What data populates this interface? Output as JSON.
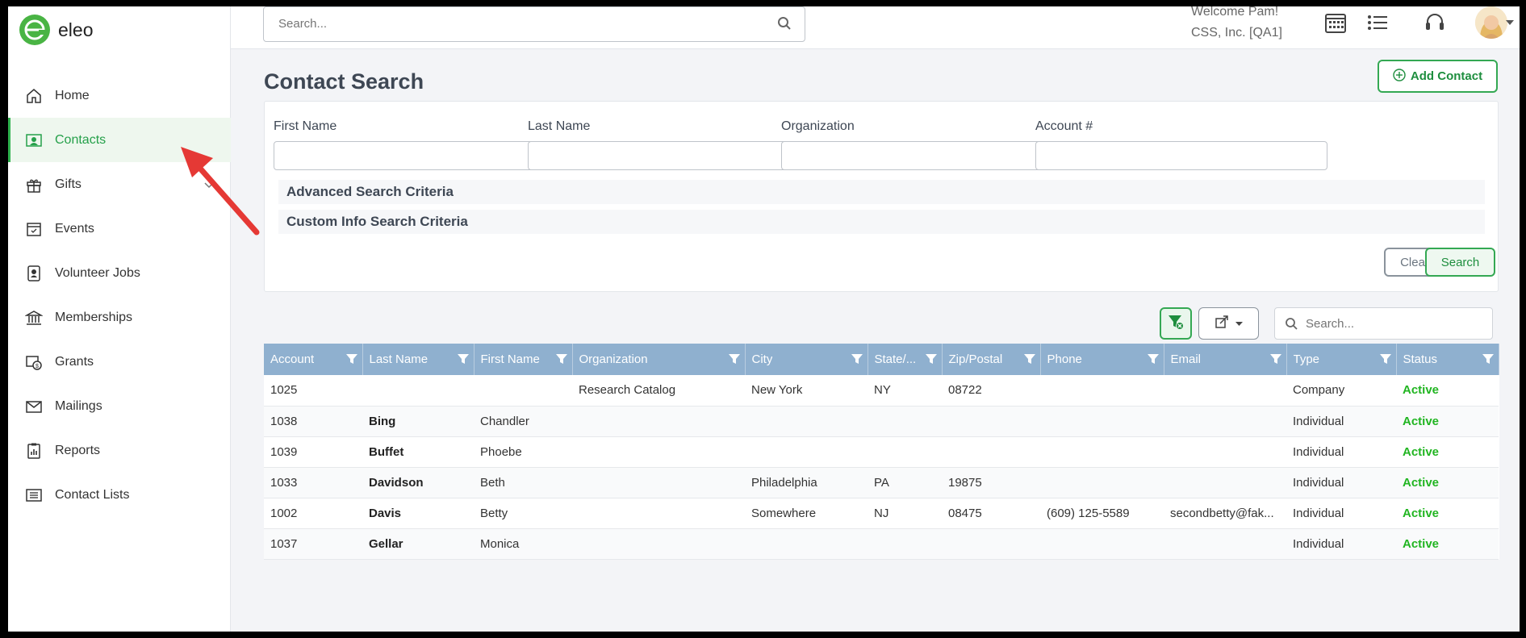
{
  "app": {
    "brand": "eleo"
  },
  "sidebar": {
    "items": [
      {
        "label": "Home",
        "icon": "home-icon"
      },
      {
        "label": "Contacts",
        "icon": "contact-card-icon",
        "active": true
      },
      {
        "label": "Gifts",
        "icon": "gift-icon",
        "expandable": true
      },
      {
        "label": "Events",
        "icon": "calendar-check-icon"
      },
      {
        "label": "Volunteer Jobs",
        "icon": "badge-icon"
      },
      {
        "label": "Memberships",
        "icon": "bank-icon"
      },
      {
        "label": "Grants",
        "icon": "grant-icon"
      },
      {
        "label": "Mailings",
        "icon": "envelope-icon"
      },
      {
        "label": "Reports",
        "icon": "clipboard-chart-icon"
      },
      {
        "label": "Contact Lists",
        "icon": "list-icon"
      }
    ]
  },
  "header": {
    "search_placeholder": "Search...",
    "welcome": "Welcome Pam!",
    "org": "CSS, Inc. [QA1]"
  },
  "page": {
    "title": "Contact Search",
    "add_contact_label": "Add Contact"
  },
  "search_form": {
    "fields": [
      {
        "label": "First Name",
        "value": ""
      },
      {
        "label": "Last Name",
        "value": ""
      },
      {
        "label": "Organization",
        "value": ""
      },
      {
        "label": "Account #",
        "value": ""
      }
    ],
    "advanced_label": "Advanced Search Criteria",
    "custom_label": "Custom Info Search Criteria",
    "clear_label": "Clear",
    "search_label": "Search"
  },
  "grid": {
    "search_placeholder": "Search...",
    "columns": [
      "Account",
      "Last Name",
      "First Name",
      "Organization",
      "City",
      "State/...",
      "Zip/Postal",
      "Phone",
      "Email",
      "Type",
      "Status"
    ],
    "rows": [
      [
        "1025",
        "",
        "",
        "Research Catalog",
        "New York",
        "NY",
        "08722",
        "",
        "",
        "Company",
        "Active"
      ],
      [
        "1038",
        "Bing",
        "Chandler",
        "",
        "",
        "",
        "",
        "",
        "",
        "Individual",
        "Active"
      ],
      [
        "1039",
        "Buffet",
        "Phoebe",
        "",
        "",
        "",
        "",
        "",
        "",
        "Individual",
        "Active"
      ],
      [
        "1033",
        "Davidson",
        "Beth",
        "",
        "Philadelphia",
        "PA",
        "19875",
        "",
        "",
        "Individual",
        "Active"
      ],
      [
        "1002",
        "Davis",
        "Betty",
        "",
        "Somewhere",
        "NJ",
        "08475",
        "(609) 125-5589",
        "secondbetty@fak...",
        "Individual",
        "Active"
      ],
      [
        "1037",
        "Gellar",
        "Monica",
        "",
        "",
        "",
        "",
        "",
        "",
        "Individual",
        "Active"
      ]
    ]
  },
  "colors": {
    "accent": "#2fb24e",
    "header_bg": "#8fb0cf",
    "status_active": "#21b521",
    "annotation": "#e53935"
  }
}
